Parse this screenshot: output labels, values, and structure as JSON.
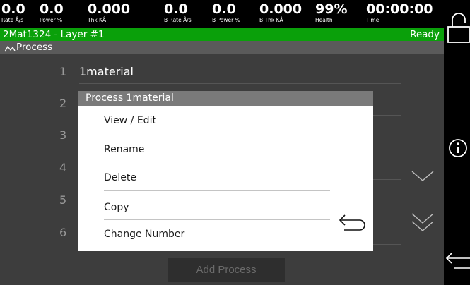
{
  "metrics": [
    {
      "value": "0.0",
      "label": "Rate Å/s"
    },
    {
      "value": "0.0",
      "label": "Power %"
    },
    {
      "value": "0.000",
      "label": "Thk KÅ"
    },
    {
      "value": "0.0",
      "label": "B Rate Å/s"
    },
    {
      "value": "0.0",
      "label": "B Power %"
    },
    {
      "value": "0.000",
      "label": "B Thk KÅ"
    },
    {
      "value": "99%",
      "label": "Health"
    },
    {
      "value": "00:00:00",
      "label": "Time"
    }
  ],
  "status": {
    "layer": "2Mat1324 - Layer #1",
    "state": "Ready"
  },
  "breadcrumb": {
    "icon": "process-graph-icon",
    "label": "Process"
  },
  "process_list": [
    {
      "number": "1",
      "name": "1material"
    },
    {
      "number": "2",
      "name": ""
    },
    {
      "number": "3",
      "name": ""
    },
    {
      "number": "4",
      "name": ""
    },
    {
      "number": "5",
      "name": ""
    },
    {
      "number": "6",
      "name": ""
    }
  ],
  "add_process_label": "Add Process",
  "dialog": {
    "title": "Process 1material",
    "items": [
      {
        "label": "View / Edit"
      },
      {
        "label": "Rename"
      },
      {
        "label": "Delete"
      },
      {
        "label": "Copy"
      },
      {
        "label": "Change Number"
      }
    ],
    "back_icon": "return-arrow-icon"
  },
  "side_icons": [
    "lock-icon",
    "info-icon",
    "back-arrow-icon"
  ],
  "list_icons": [
    "chevron-down-icon",
    "double-chevron-down-icon"
  ],
  "colors": {
    "status_bar": "#0aa00a",
    "breadcrumb_bg": "#5a5a5a",
    "main_bg": "#3d3d3d",
    "dialog_title_bg": "#7a7a7a"
  }
}
